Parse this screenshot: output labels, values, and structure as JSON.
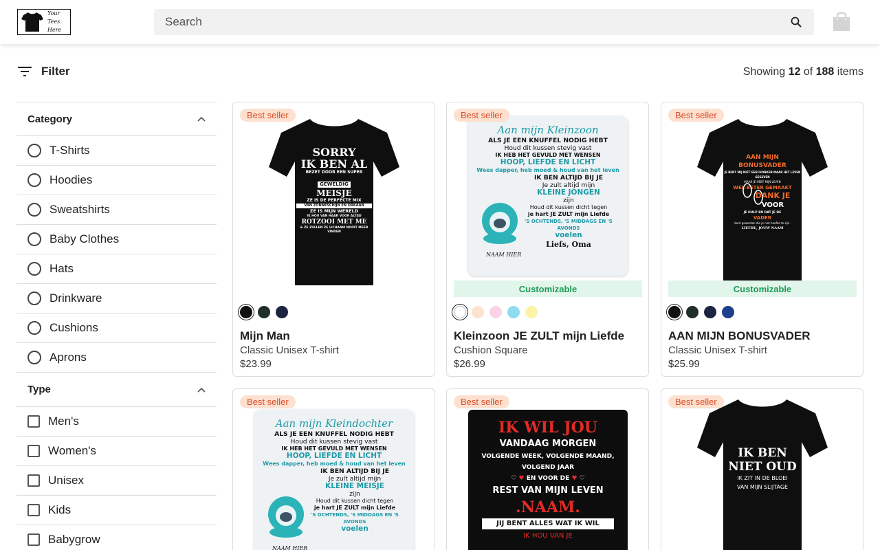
{
  "header": {
    "logo_lines": [
      "Your",
      "Tees",
      "Here"
    ],
    "search_placeholder": "Search"
  },
  "toolbar": {
    "filter_label": "Filter",
    "showing_prefix": "Showing",
    "showing_count": "12",
    "showing_of": "of",
    "showing_total": "188",
    "showing_suffix": "items"
  },
  "sidebar": {
    "category": {
      "title": "Category",
      "options": [
        "T-Shirts",
        "Hoodies",
        "Sweatshirts",
        "Baby Clothes",
        "Hats",
        "Drinkware",
        "Cushions",
        "Aprons"
      ]
    },
    "type": {
      "title": "Type",
      "options": [
        "Men's",
        "Women's",
        "Unisex",
        "Kids",
        "Babygrow"
      ]
    }
  },
  "products": [
    {
      "badge": "Best seller",
      "name": "Mijn Man",
      "type": "Classic Unisex T-shirt",
      "price": "$23.99",
      "swatches": [
        "#111111",
        "#1f3028",
        "#1c2540"
      ],
      "print_lines": [
        "SORRY",
        "IK BEN AL",
        "BEZET DOOR EEN SUPER",
        "GEWELDIG",
        "MEISJE",
        "ZE IS DE PERFECTE MIX",
        "VAN ZONNESCHIJN EN ORKAAN",
        "ZE IS MIJN WERELD",
        "IK HOU VAN HAAR VOOR ALTIJD",
        "ROTZOOI MET ME",
        "& ZE ZULLEN ZE LICHAAM NOOIT MEER VINDEN"
      ]
    },
    {
      "badge": "Best seller",
      "customizable": "Customizable",
      "name": "Kleinzoon JE ZULT mijn Liefde",
      "type": "Cushion Square",
      "price": "$26.99",
      "swatches": [
        "#ffffff",
        "#fde3cf",
        "#fbd3e4",
        "#8fdcf1",
        "#fdf3a8"
      ],
      "print_lines": [
        "Aan mijn Kleinzoon",
        "ALS JE EEN KNUFFEL NODIG HEBT",
        "Houd dit kussen stevig vast",
        "IK HEB HET GEVULD MET WENSEN",
        "HOOP, LIEFDE EN LICHT",
        "Wees dapper, heb moed & houd van het leven",
        "IK BEN ALTIJD BIJ JE",
        "Je zult altijd mijn",
        "KLEINE JONGEN",
        "zijn",
        "Houd dit kussen dicht tegen",
        "je hart JE ZULT mijn Liefde",
        "'S OCHTENDS, 'S MIDDAGS EN 'S AVONDS",
        "voelen",
        "Liefs, Oma",
        "NAAM HIER"
      ]
    },
    {
      "badge": "Best seller",
      "customizable": "Customizable",
      "name": "AAN MIJN BONUSVADER",
      "type": "Classic Unisex T-shirt",
      "price": "$25.99",
      "swatches": [
        "#111111",
        "#1f3028",
        "#1c2540",
        "#1e3f8c"
      ],
      "print_lines": [
        "AAN MIJN BONUSVADER",
        "JE BENT MIJ NIET GESCHONKEN MAAR HET LEVEN GEGEVEN",
        "MAAR JE HEBT MIJN LEVEN",
        "WEL BETER GEMAAKT",
        "DANK JE",
        "VOOR",
        "JE HULP EN DAT JE DE",
        "VADER",
        "bent geworden die je niet hoefde te zijn.",
        "LIEFDE, JOUW NAAM"
      ]
    },
    {
      "badge": "Best seller",
      "print_lines": [
        "Aan mijn Kleindochter",
        "ALS JE EEN KNUFFEL NODIG HEBT",
        "Houd dit kussen stevig vast",
        "IK HEB HET GEVULD MET WENSEN",
        "HOOP, LIEFDE EN LICHT",
        "Wees dapper, heb moed & houd van het leven",
        "IK BEN ALTIJD BIJ JE",
        "Je zult altijd mijn",
        "KLEINE MEISJE",
        "zijn",
        "Houd dit kussen dicht tegen",
        "je hart JE ZULT mijn Liefde",
        "'S OCHTENDS, 'S MIDDAGS EN 'S AVONDS",
        "voelen",
        "NAAM HIER"
      ]
    },
    {
      "badge": "Best seller",
      "print_lines": [
        "IK WIL JOU",
        "VANDAAG MORGEN",
        "VOLGENDE WEEK, VOLGENDE MAAND,",
        "VOLGEND JAAR",
        "EN VOOR DE",
        "REST VAN MIJN LEVEN",
        ".NAAM.",
        "JIJ BENT ALLES WAT IK WIL",
        "IK HOU VAN JE"
      ]
    },
    {
      "badge": "Best seller",
      "print_lines": [
        "IK BEN",
        "NIET OUD",
        "IK ZIT IN DE BLOEI",
        "VAN MIJN SLIJTAGE"
      ]
    }
  ]
}
